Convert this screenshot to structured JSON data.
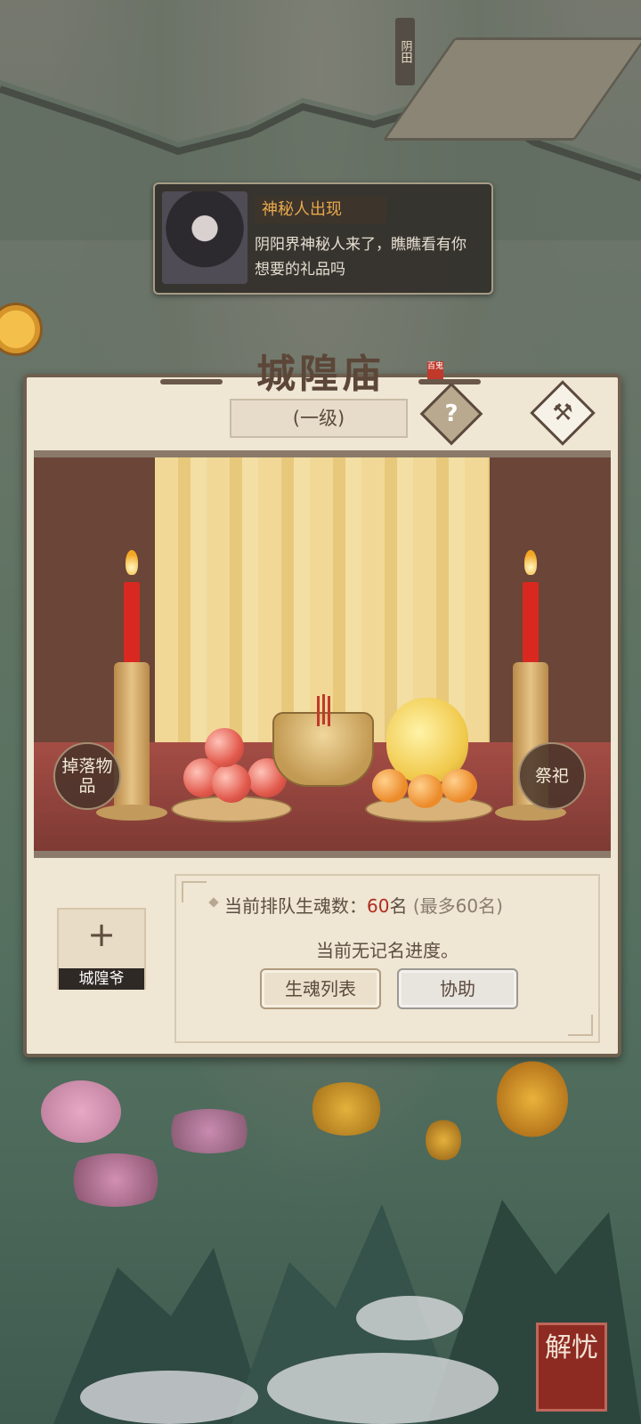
{
  "map": {
    "field_sign": "阴田"
  },
  "notification": {
    "title": "神秘人出现",
    "message": "阴阳界神秘人来了，瞧瞧看有你想要的礼品吗"
  },
  "panel": {
    "title": "城隍庙",
    "stamp": "百鬼",
    "level": "(一级)",
    "help_icon_glyph": "?",
    "build_icon_glyph": "⚒",
    "left_action": "掉落物品",
    "right_action": "祭祀"
  },
  "info": {
    "slot_plus": "+",
    "slot_label": "城隍爷",
    "queue_label": "当前排队生魂数：",
    "queue_count": "60",
    "queue_unit": "名",
    "queue_max": "(最多60名)",
    "progress_text": "当前无记名进度。",
    "list_button": "生魂列表",
    "assist_button": "协助"
  },
  "corner_seal": "解忧"
}
